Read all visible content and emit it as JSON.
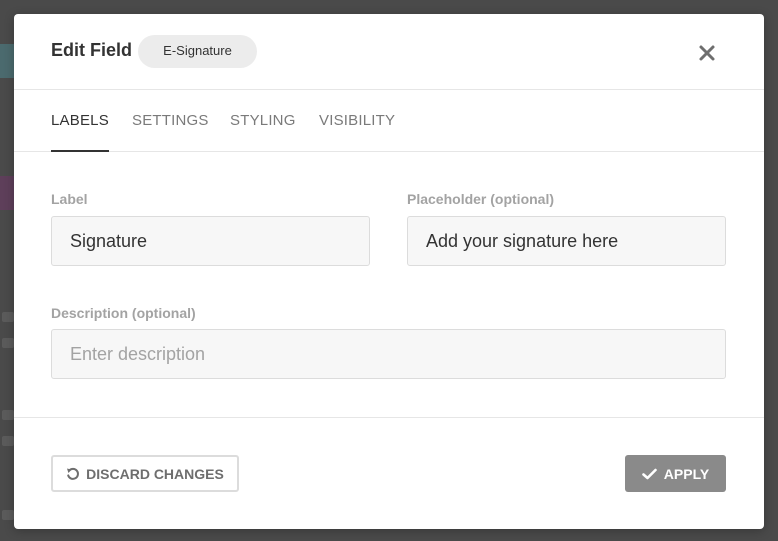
{
  "modal": {
    "title": "Edit Field",
    "field_type": "E-Signature"
  },
  "tabs": [
    {
      "label": "LABELS",
      "active": true
    },
    {
      "label": "SETTINGS",
      "active": false
    },
    {
      "label": "STYLING",
      "active": false
    },
    {
      "label": "VISIBILITY",
      "active": false
    }
  ],
  "form": {
    "label": {
      "label": "Label",
      "value": "Signature"
    },
    "placeholder": {
      "label": "Placeholder (optional)",
      "value": "Add your signature here"
    },
    "description": {
      "label": "Description (optional)",
      "value": "",
      "placeholder": "Enter description"
    }
  },
  "footer": {
    "discard_label": "DISCARD CHANGES",
    "apply_label": "APPLY"
  },
  "icons": {
    "close": "close-icon",
    "discard": "undo-icon",
    "apply": "check-icon"
  },
  "colors": {
    "overlay": "#4a4a4a",
    "apply_button": "#8a8a8a",
    "active_tab": "#333333",
    "inactive_tab": "#7a7a7a"
  }
}
